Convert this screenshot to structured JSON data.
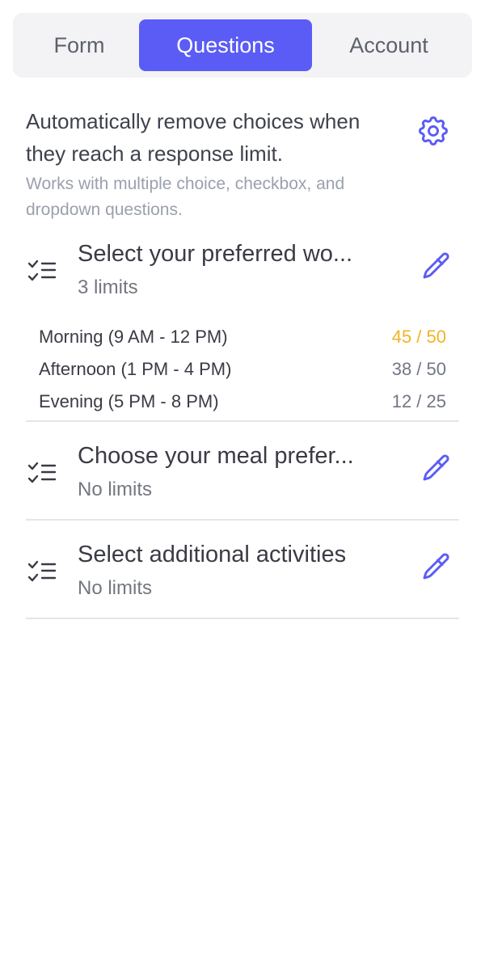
{
  "tabs": [
    {
      "label": "Form"
    },
    {
      "label": "Questions"
    },
    {
      "label": "Account"
    }
  ],
  "info": {
    "main": "Automatically remove choices when they reach a response limit.",
    "sub": "Works with multiple choice, checkbox, and dropdown questions."
  },
  "questions": [
    {
      "title": "Select your preferred wo...",
      "subtitle": "3 limits",
      "limits": [
        {
          "label": "Morning (9 AM - 12 PM)",
          "count": "45 / 50"
        },
        {
          "label": "Afternoon (1 PM - 4 PM)",
          "count": "38 / 50"
        },
        {
          "label": "Evening (5 PM - 8 PM)",
          "count": "12 / 25"
        }
      ]
    },
    {
      "title": "Choose your meal prefer...",
      "subtitle": "No limits"
    },
    {
      "title": "Select additional activities",
      "subtitle": "No limits"
    }
  ],
  "colors": {
    "accent": "#5b5cf6",
    "warning": "#f3b323"
  },
  "icons": {
    "settings": "gear-icon",
    "question": "checklist-icon",
    "edit": "pencil-icon"
  }
}
